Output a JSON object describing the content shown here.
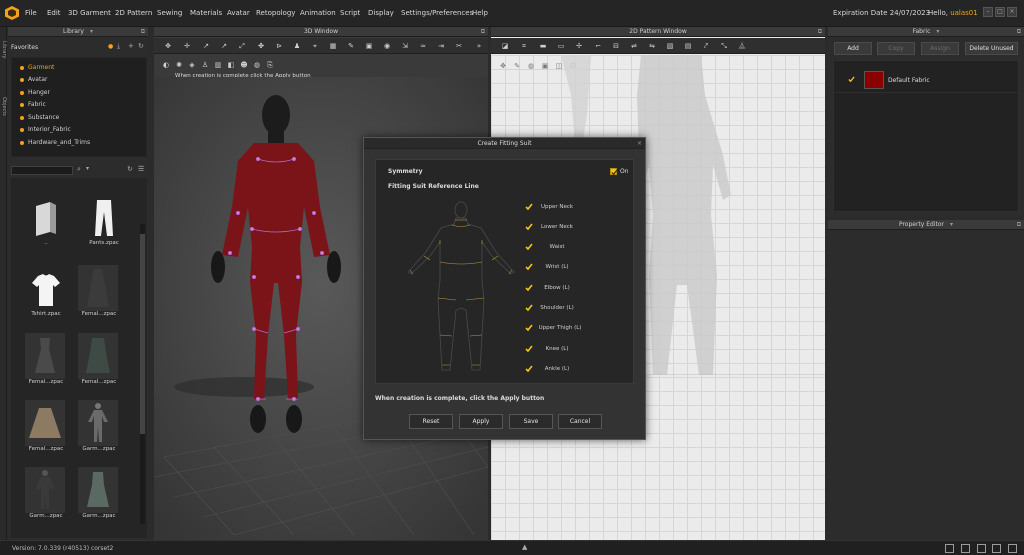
{
  "menu": {
    "items": [
      "File",
      "Edit",
      "3D Garment",
      "2D Pattern",
      "Sewing",
      "Materials",
      "Avatar",
      "Retopology",
      "Animation",
      "Script",
      "Display",
      "Settings/Preferences",
      "Help"
    ],
    "expiration": "Expiration Date 24/07/2023",
    "hello_prefix": "Hello, ",
    "username": "ualas01"
  },
  "side_strip": [
    "Library",
    "Objects"
  ],
  "library": {
    "title": "Library",
    "favorites_label": "Favorites",
    "favorites": [
      "Garment",
      "Avatar",
      "Hanger",
      "Fabric",
      "Substance",
      "Interior_Fabric",
      "Hardware_and_Trims"
    ],
    "items": [
      {
        "label": "..",
        "icon": "folder-icon"
      },
      {
        "label": "Pants.zpac",
        "icon": "pants-icon"
      },
      {
        "label": "Tshirt.zpac",
        "icon": "tshirt-icon"
      },
      {
        "label": "Femal...zpac",
        "icon": "dress-icon"
      },
      {
        "label": "Femal...zpac",
        "icon": "dress-icon"
      },
      {
        "label": "Femal...zpac",
        "icon": "dress-icon"
      },
      {
        "label": "Femal...zpac",
        "icon": "skirt-icon"
      },
      {
        "label": "Garm...zpac",
        "icon": "mannequin-icon"
      },
      {
        "label": "Garm...zpac",
        "icon": "mannequin-icon"
      },
      {
        "label": "Garm...zpac",
        "icon": "dress-icon"
      }
    ]
  },
  "window3d": {
    "title": "3D Window",
    "hint": "When creation is complete click the Apply button"
  },
  "window2d": {
    "title": "2D Pattern Window"
  },
  "fabric": {
    "title": "Fabric",
    "buttons": [
      {
        "label": "Add",
        "enabled": true
      },
      {
        "label": "Copy",
        "enabled": false
      },
      {
        "label": "Assign",
        "enabled": false
      },
      {
        "label": "Delete Unused",
        "enabled": true
      }
    ],
    "items": [
      {
        "name": "Default Fabric",
        "checked": true,
        "color": "#8b0000"
      }
    ]
  },
  "property_editor": {
    "title": "Property Editor"
  },
  "dialog": {
    "title": "Create Fitting Suit",
    "symmetry_label": "Symmetry",
    "symmetry_on_label": "On",
    "symmetry_on": true,
    "reference_heading": "Fitting Suit Reference Line",
    "reference_lines": [
      {
        "label": "Upper Neck",
        "checked": true
      },
      {
        "label": "Lower Neck",
        "checked": true
      },
      {
        "label": "Waist",
        "checked": true
      },
      {
        "label": "Wrist (L)",
        "checked": true
      },
      {
        "label": "Elbow (L)",
        "checked": true
      },
      {
        "label": "Shoulder (L)",
        "checked": true
      },
      {
        "label": "Upper Thigh (L)",
        "checked": true
      },
      {
        "label": "Knee (L)",
        "checked": true
      },
      {
        "label": "Ankle (L)",
        "checked": true
      }
    ],
    "note": "When creation is complete, click the Apply button",
    "buttons": [
      "Reset",
      "Apply",
      "Save",
      "Cancel"
    ]
  },
  "status": {
    "version": "Version:   7.0.339 (r40513)   corset2"
  },
  "colors": {
    "accent": "#f2a21c",
    "check": "#f2c318",
    "suit": "#7a1418"
  }
}
